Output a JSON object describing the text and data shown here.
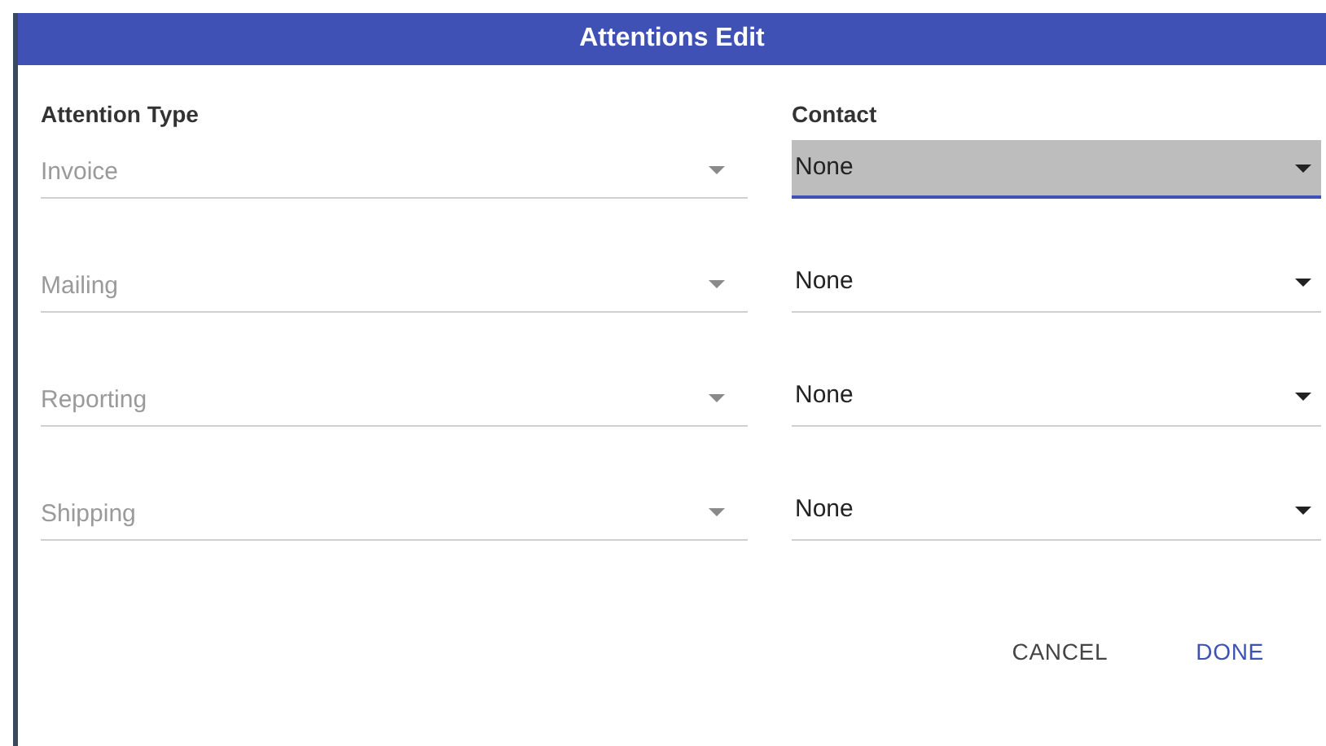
{
  "dialog": {
    "title": "Attentions Edit"
  },
  "columns": [
    "Attention Type",
    "Contact"
  ],
  "rows": [
    {
      "type": {
        "value": "Invoice",
        "disabled": true
      },
      "contact": {
        "value": "None",
        "focused": true
      }
    },
    {
      "type": {
        "value": "Mailing",
        "disabled": true
      },
      "contact": {
        "value": "None",
        "focused": false
      }
    },
    {
      "type": {
        "value": "Reporting",
        "disabled": true
      },
      "contact": {
        "value": "None",
        "focused": false
      }
    },
    {
      "type": {
        "value": "Shipping",
        "disabled": true
      },
      "contact": {
        "value": "None",
        "focused": false
      }
    }
  ],
  "buttons": [
    {
      "label": "CANCEL",
      "kind": "secondary"
    },
    {
      "label": "DONE",
      "kind": "primary"
    }
  ]
}
